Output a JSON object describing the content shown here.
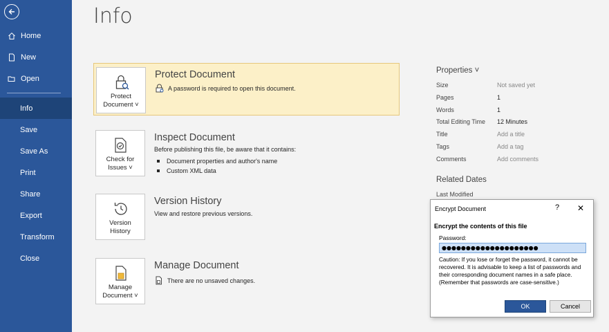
{
  "sidebar": {
    "items": [
      {
        "label": "Home",
        "icon": "home-icon"
      },
      {
        "label": "New",
        "icon": "new-document-icon"
      },
      {
        "label": "Open",
        "icon": "folder-open-icon"
      },
      {
        "label": "Info",
        "active": true
      },
      {
        "label": "Save"
      },
      {
        "label": "Save As"
      },
      {
        "label": "Print"
      },
      {
        "label": "Share"
      },
      {
        "label": "Export"
      },
      {
        "label": "Transform"
      },
      {
        "label": "Close"
      }
    ]
  },
  "page": {
    "title": "Info"
  },
  "cards": {
    "protect": {
      "button_line1": "Protect",
      "button_line2": "Document ˅",
      "title": "Protect Document",
      "desc": "A password is required to open this document."
    },
    "inspect": {
      "button_line1": "Check for",
      "button_line2": "Issues ˅",
      "title": "Inspect Document",
      "desc": "Before publishing this file, be aware that it contains:",
      "bullets": [
        "Document properties and author's name",
        "Custom XML data"
      ]
    },
    "version": {
      "button_line1": "Version",
      "button_line2": "History",
      "title": "Version History",
      "desc": "View and restore previous versions."
    },
    "manage": {
      "button_line1": "Manage",
      "button_line2": "Document ˅",
      "title": "Manage Document",
      "desc": "There are no unsaved changes."
    }
  },
  "properties": {
    "heading": "Properties ˅",
    "rows": [
      {
        "key": "Size",
        "value": "Not saved yet"
      },
      {
        "key": "Pages",
        "value": "1"
      },
      {
        "key": "Words",
        "value": "1"
      },
      {
        "key": "Total Editing Time",
        "value": "12 Minutes"
      },
      {
        "key": "Title",
        "value": "Add a title"
      },
      {
        "key": "Tags",
        "value": "Add a tag"
      },
      {
        "key": "Comments",
        "value": "Add comments"
      }
    ],
    "related_heading": "Related Dates",
    "last_modified_label": "Last Modified"
  },
  "dialog": {
    "title": "Encrypt Document",
    "help": "?",
    "close": "✕",
    "heading": "Encrypt the contents of this file",
    "password_label": "Password:",
    "password_value": "●●●●●●●●●●●●●●●●●●●●",
    "caution": "Caution: If you lose or forget the password, it cannot be recovered. It is advisable to keep a list of passwords and their corresponding document names in a safe place.",
    "caution_note": "(Remember that passwords are case-sensitive.)",
    "ok_label": "OK",
    "cancel_label": "Cancel"
  },
  "colors": {
    "sidebar_bg": "#2b579a",
    "sidebar_active": "#1e4478",
    "highlight_bg": "#fcf0c8",
    "ok_button": "#2b579a"
  }
}
